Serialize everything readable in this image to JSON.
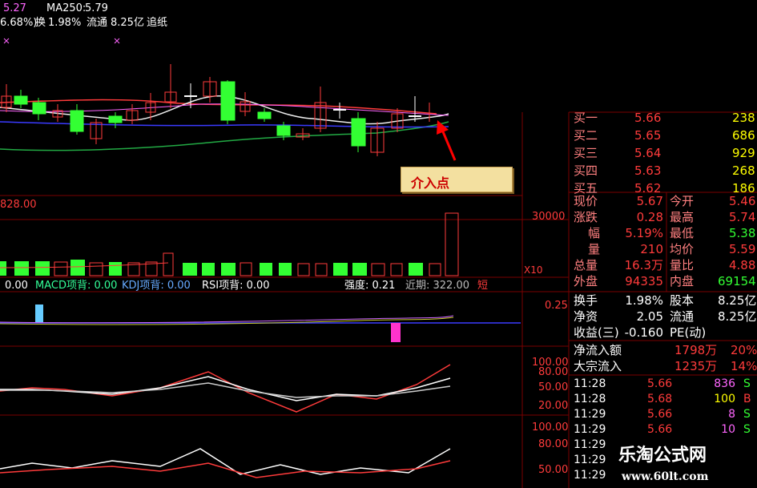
{
  "colors": {
    "bg": "#000000",
    "red": "#ff3b3b",
    "green": "#33ff33",
    "white": "#ffffff",
    "yellow": "#ffff00",
    "cyan": "#00ffff",
    "magenta": "#ff33ff",
    "blue": "#3a3aff",
    "grid": "#7a0000"
  },
  "header": {
    "ma_prev": "5.27",
    "ma250_label": "MA250:",
    "ma250_value": "5.79",
    "line2_pct": "6.68%)",
    "line2_turn_label": "换",
    "line2_turn": "1.98%",
    "line2_float_label": "流通",
    "line2_float": "8.25亿",
    "line2_extra": "追纸"
  },
  "annotation": {
    "label": "介入点"
  },
  "volume": {
    "axis_top": "828.00",
    "axis_right": "30000",
    "mult": "X10"
  },
  "indicator_bar": {
    "v0": "0.00",
    "macd": "MACD项背: 0.00",
    "kdj": "KDJ项背: 0.00",
    "rsi": "RSI项背: 0.00",
    "strength": "强度: 0.21",
    "recent": "近期: 322.00",
    "flag": "短"
  },
  "macd_axis": {
    "val": "0.25"
  },
  "kdj_axis": {
    "v1": "100.00",
    "v2": "80.00",
    "v3": "50.00",
    "v4": "20.00"
  },
  "rsi_axis": {
    "v1": "100.00",
    "v2": "80.00",
    "v3": "50.00"
  },
  "order_book": [
    {
      "label": "买一",
      "price": "5.66",
      "vol": "238"
    },
    {
      "label": "买二",
      "price": "5.65",
      "vol": "686"
    },
    {
      "label": "买三",
      "price": "5.64",
      "vol": "929"
    },
    {
      "label": "买四",
      "price": "5.63",
      "vol": "268"
    },
    {
      "label": "买五",
      "price": "5.62",
      "vol": "186"
    }
  ],
  "quote": [
    {
      "l1": "现价",
      "v1": "5.67",
      "l2": "今开",
      "v2": "5.46"
    },
    {
      "l1": "涨跌",
      "v1": "0.28",
      "l2": "最高",
      "v2": "5.74"
    },
    {
      "l1": "幅",
      "v1": "5.19%",
      "l2": "最低",
      "v2": "5.38"
    },
    {
      "l1": "量",
      "v1": "210",
      "l2": "均价",
      "v2": "5.59"
    },
    {
      "l1": "总量",
      "v1": "16.3万",
      "l2": "量比",
      "v2": "4.88"
    },
    {
      "l1": "外盘",
      "v1": "94335",
      "l2": "内盘",
      "v2": "69154"
    }
  ],
  "stats": [
    {
      "l1": "换手",
      "v1": "1.98%",
      "l2": "股本",
      "v2": "8.25亿"
    },
    {
      "l1": "净资",
      "v1": "2.05",
      "l2": "流通",
      "v2": "8.25亿"
    },
    {
      "l1": "收益(三)",
      "v1": "-0.160",
      "l2": "PE(动)",
      "v2": ""
    }
  ],
  "flow": [
    {
      "label": "净流入额",
      "value": "1798万",
      "pct": "20%"
    },
    {
      "label": "大宗流入",
      "value": "1235万",
      "pct": "14%"
    }
  ],
  "ticks": [
    {
      "time": "11:28",
      "price": "5.66",
      "vol": "836",
      "side": "S"
    },
    {
      "time": "11:28",
      "price": "5.68",
      "vol": "100",
      "side": "B"
    },
    {
      "time": "11:29",
      "price": "5.66",
      "vol": "8",
      "side": "S"
    },
    {
      "time": "11:29",
      "price": "5.66",
      "vol": "10",
      "side": "S"
    },
    {
      "time": "11:29",
      "price": "",
      "vol": "",
      "side": ""
    },
    {
      "time": "11:29",
      "price": "",
      "vol": "",
      "side": ""
    },
    {
      "time": "11:29",
      "price": "",
      "vol": "",
      "side": ""
    }
  ],
  "watermark": {
    "title": "乐淘公式网",
    "url": "www.60lt.com"
  }
}
